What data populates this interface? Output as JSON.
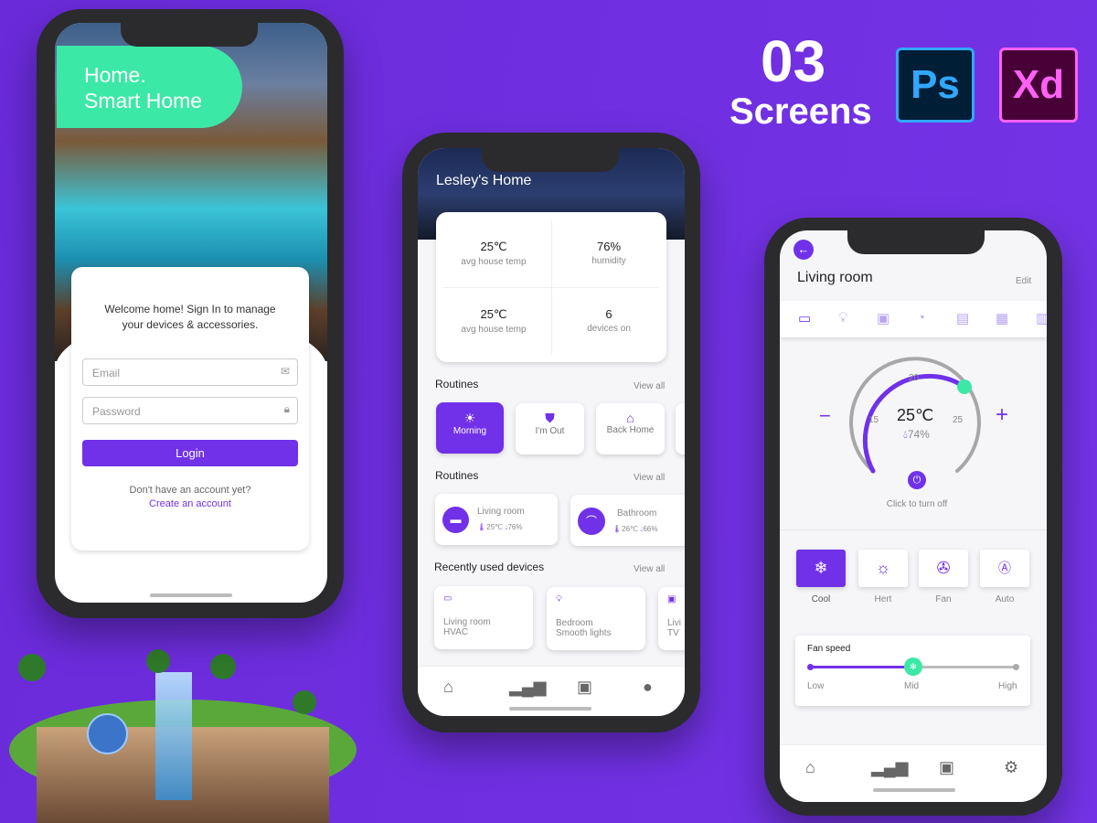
{
  "promo": {
    "count": "03",
    "label": "Screens",
    "apps": [
      "Ps",
      "Xd"
    ],
    "colors": {
      "ps": "#31a8ff",
      "ps_bg": "#001e36",
      "xd": "#ff61f6",
      "xd_bg": "#470137",
      "accent": "#7131e8",
      "mint": "#3ce8a6"
    }
  },
  "login": {
    "brand_line1": "Home.",
    "brand_line2": "Smart Home",
    "welcome": "Welcome home! Sign In to manage your devices & accessories.",
    "email_placeholder": "Email",
    "password_placeholder": "Password",
    "login_button": "Login",
    "no_account": "Don't have an account yet?",
    "create_account": "Create an account"
  },
  "home": {
    "title": "Lesley's Home",
    "stats": [
      {
        "value": "25℃",
        "label": "avg house temp"
      },
      {
        "value": "76%",
        "label": "humidity"
      },
      {
        "value": "25℃",
        "label": "avg house temp"
      },
      {
        "value": "6",
        "label": "devices on"
      }
    ],
    "routines_title": "Routines",
    "view_all": "View all",
    "routines": [
      {
        "label": "Morning",
        "icon": "sunrise-icon"
      },
      {
        "label": "I'm Out",
        "icon": "shield-icon"
      },
      {
        "label": "Back Home",
        "icon": "home-icon"
      }
    ],
    "rooms_title": "Routines",
    "rooms": [
      {
        "name": "Living room",
        "temp": "25℃",
        "humidity": "76%"
      },
      {
        "name": "Bathroom",
        "temp": "26℃",
        "humidity": "66%"
      }
    ],
    "recent_title": "Recently used devices",
    "devices": [
      {
        "line1": "Living room",
        "line2": "HVAC"
      },
      {
        "line1": "Bedroom",
        "line2": "Smooth lights"
      },
      {
        "line1": "Livi",
        "line2": "TV"
      }
    ]
  },
  "room": {
    "title": "Living room",
    "edit": "Edit",
    "temp": "25℃",
    "humidity": "74%",
    "dial_labels": [
      "15",
      "20",
      "25"
    ],
    "turn_off": "Click to turn off",
    "modes": [
      {
        "label": "Cool",
        "icon": "snowflake-icon",
        "active": true
      },
      {
        "label": "Hert",
        "icon": "sun-icon"
      },
      {
        "label": "Fan",
        "icon": "fan-icon"
      },
      {
        "label": "Auto",
        "icon": "auto-icon"
      }
    ],
    "fan_speed_title": "Fan speed",
    "fan_levels": [
      "Low",
      "Mid",
      "High"
    ],
    "fan_speed_value": 0.5
  }
}
